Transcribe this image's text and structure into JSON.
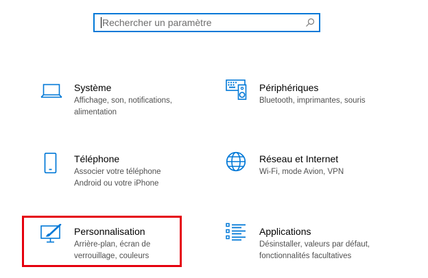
{
  "search": {
    "placeholder": "Rechercher un paramètre",
    "value": ""
  },
  "tiles": [
    {
      "title": "Système",
      "desc_line1": "Affichage, son, notifications,",
      "desc_line2": "alimentation",
      "icon": "laptop-icon"
    },
    {
      "title": "Périphériques",
      "desc_line1": "Bluetooth, imprimantes, souris",
      "desc_line2": "",
      "icon": "devices-icon"
    },
    {
      "title": "Téléphone",
      "desc_line1": "Associer votre téléphone",
      "desc_line2": "Android ou votre iPhone",
      "icon": "phone-icon"
    },
    {
      "title": "Réseau et Internet",
      "desc_line1": "Wi-Fi, mode Avion, VPN",
      "desc_line2": "",
      "icon": "globe-icon"
    },
    {
      "title": "Personnalisation",
      "desc_line1": "Arrière-plan, écran de",
      "desc_line2": "verrouillage, couleurs",
      "icon": "personalization-icon"
    },
    {
      "title": "Applications",
      "desc_line1": "Désinstaller, valeurs par défaut,",
      "desc_line2": "fonctionnalités facultatives",
      "icon": "apps-list-icon"
    }
  ],
  "colors": {
    "accent": "#0078d7",
    "highlight": "#e5000d",
    "description": "#505050"
  }
}
